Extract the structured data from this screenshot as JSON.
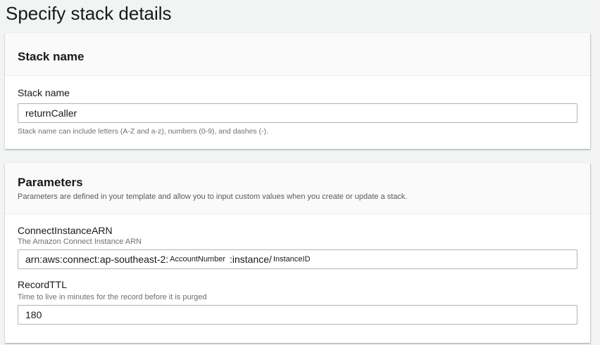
{
  "page_title": "Specify stack details",
  "stack_panel": {
    "header": "Stack name",
    "field_label": "Stack name",
    "field_value": "returnCaller",
    "hint": "Stack name can include letters (A-Z and a-z), numbers (0-9), and dashes (-)."
  },
  "parameters_panel": {
    "header": "Parameters",
    "description": "Parameters are defined in your template and allow you to input custom values when you create or update a stack.",
    "params": [
      {
        "label": "ConnectInstanceARN",
        "description": "The Amazon Connect Instance ARN",
        "value_prefix": "arn:aws:connect:ap-southeast-2:",
        "value_account": "AccountNumber",
        "value_middle": ":instance/",
        "value_instance": "InstanceID"
      },
      {
        "label": "RecordTTL",
        "description": "Time to live in minutes for the record before it is purged",
        "value": "180"
      }
    ]
  }
}
